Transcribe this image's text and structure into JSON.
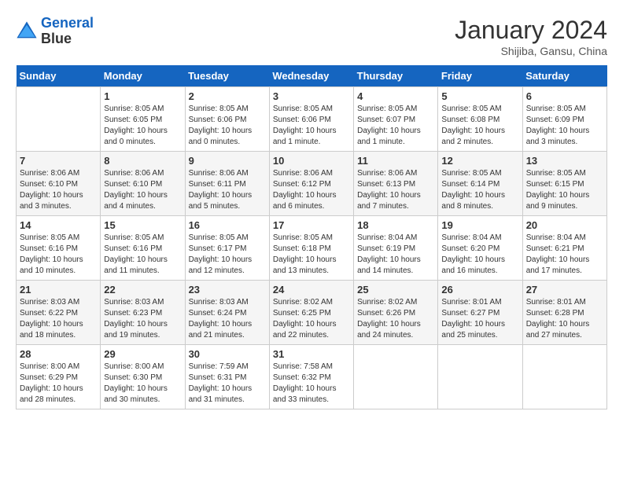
{
  "header": {
    "logo_line1": "General",
    "logo_line2": "Blue",
    "title": "January 2024",
    "subtitle": "Shijiba, Gansu, China"
  },
  "days_of_week": [
    "Sunday",
    "Monday",
    "Tuesday",
    "Wednesday",
    "Thursday",
    "Friday",
    "Saturday"
  ],
  "weeks": [
    [
      {
        "day": "",
        "sunrise": "",
        "sunset": "",
        "daylight": "",
        "empty": true
      },
      {
        "day": "1",
        "sunrise": "Sunrise: 8:05 AM",
        "sunset": "Sunset: 6:05 PM",
        "daylight": "Daylight: 10 hours and 0 minutes."
      },
      {
        "day": "2",
        "sunrise": "Sunrise: 8:05 AM",
        "sunset": "Sunset: 6:06 PM",
        "daylight": "Daylight: 10 hours and 0 minutes."
      },
      {
        "day": "3",
        "sunrise": "Sunrise: 8:05 AM",
        "sunset": "Sunset: 6:06 PM",
        "daylight": "Daylight: 10 hours and 1 minute."
      },
      {
        "day": "4",
        "sunrise": "Sunrise: 8:05 AM",
        "sunset": "Sunset: 6:07 PM",
        "daylight": "Daylight: 10 hours and 1 minute."
      },
      {
        "day": "5",
        "sunrise": "Sunrise: 8:05 AM",
        "sunset": "Sunset: 6:08 PM",
        "daylight": "Daylight: 10 hours and 2 minutes."
      },
      {
        "day": "6",
        "sunrise": "Sunrise: 8:05 AM",
        "sunset": "Sunset: 6:09 PM",
        "daylight": "Daylight: 10 hours and 3 minutes."
      }
    ],
    [
      {
        "day": "7",
        "sunrise": "Sunrise: 8:06 AM",
        "sunset": "Sunset: 6:10 PM",
        "daylight": "Daylight: 10 hours and 3 minutes."
      },
      {
        "day": "8",
        "sunrise": "Sunrise: 8:06 AM",
        "sunset": "Sunset: 6:10 PM",
        "daylight": "Daylight: 10 hours and 4 minutes."
      },
      {
        "day": "9",
        "sunrise": "Sunrise: 8:06 AM",
        "sunset": "Sunset: 6:11 PM",
        "daylight": "Daylight: 10 hours and 5 minutes."
      },
      {
        "day": "10",
        "sunrise": "Sunrise: 8:06 AM",
        "sunset": "Sunset: 6:12 PM",
        "daylight": "Daylight: 10 hours and 6 minutes."
      },
      {
        "day": "11",
        "sunrise": "Sunrise: 8:06 AM",
        "sunset": "Sunset: 6:13 PM",
        "daylight": "Daylight: 10 hours and 7 minutes."
      },
      {
        "day": "12",
        "sunrise": "Sunrise: 8:05 AM",
        "sunset": "Sunset: 6:14 PM",
        "daylight": "Daylight: 10 hours and 8 minutes."
      },
      {
        "day": "13",
        "sunrise": "Sunrise: 8:05 AM",
        "sunset": "Sunset: 6:15 PM",
        "daylight": "Daylight: 10 hours and 9 minutes."
      }
    ],
    [
      {
        "day": "14",
        "sunrise": "Sunrise: 8:05 AM",
        "sunset": "Sunset: 6:16 PM",
        "daylight": "Daylight: 10 hours and 10 minutes."
      },
      {
        "day": "15",
        "sunrise": "Sunrise: 8:05 AM",
        "sunset": "Sunset: 6:16 PM",
        "daylight": "Daylight: 10 hours and 11 minutes."
      },
      {
        "day": "16",
        "sunrise": "Sunrise: 8:05 AM",
        "sunset": "Sunset: 6:17 PM",
        "daylight": "Daylight: 10 hours and 12 minutes."
      },
      {
        "day": "17",
        "sunrise": "Sunrise: 8:05 AM",
        "sunset": "Sunset: 6:18 PM",
        "daylight": "Daylight: 10 hours and 13 minutes."
      },
      {
        "day": "18",
        "sunrise": "Sunrise: 8:04 AM",
        "sunset": "Sunset: 6:19 PM",
        "daylight": "Daylight: 10 hours and 14 minutes."
      },
      {
        "day": "19",
        "sunrise": "Sunrise: 8:04 AM",
        "sunset": "Sunset: 6:20 PM",
        "daylight": "Daylight: 10 hours and 16 minutes."
      },
      {
        "day": "20",
        "sunrise": "Sunrise: 8:04 AM",
        "sunset": "Sunset: 6:21 PM",
        "daylight": "Daylight: 10 hours and 17 minutes."
      }
    ],
    [
      {
        "day": "21",
        "sunrise": "Sunrise: 8:03 AM",
        "sunset": "Sunset: 6:22 PM",
        "daylight": "Daylight: 10 hours and 18 minutes."
      },
      {
        "day": "22",
        "sunrise": "Sunrise: 8:03 AM",
        "sunset": "Sunset: 6:23 PM",
        "daylight": "Daylight: 10 hours and 19 minutes."
      },
      {
        "day": "23",
        "sunrise": "Sunrise: 8:03 AM",
        "sunset": "Sunset: 6:24 PM",
        "daylight": "Daylight: 10 hours and 21 minutes."
      },
      {
        "day": "24",
        "sunrise": "Sunrise: 8:02 AM",
        "sunset": "Sunset: 6:25 PM",
        "daylight": "Daylight: 10 hours and 22 minutes."
      },
      {
        "day": "25",
        "sunrise": "Sunrise: 8:02 AM",
        "sunset": "Sunset: 6:26 PM",
        "daylight": "Daylight: 10 hours and 24 minutes."
      },
      {
        "day": "26",
        "sunrise": "Sunrise: 8:01 AM",
        "sunset": "Sunset: 6:27 PM",
        "daylight": "Daylight: 10 hours and 25 minutes."
      },
      {
        "day": "27",
        "sunrise": "Sunrise: 8:01 AM",
        "sunset": "Sunset: 6:28 PM",
        "daylight": "Daylight: 10 hours and 27 minutes."
      }
    ],
    [
      {
        "day": "28",
        "sunrise": "Sunrise: 8:00 AM",
        "sunset": "Sunset: 6:29 PM",
        "daylight": "Daylight: 10 hours and 28 minutes."
      },
      {
        "day": "29",
        "sunrise": "Sunrise: 8:00 AM",
        "sunset": "Sunset: 6:30 PM",
        "daylight": "Daylight: 10 hours and 30 minutes."
      },
      {
        "day": "30",
        "sunrise": "Sunrise: 7:59 AM",
        "sunset": "Sunset: 6:31 PM",
        "daylight": "Daylight: 10 hours and 31 minutes."
      },
      {
        "day": "31",
        "sunrise": "Sunrise: 7:58 AM",
        "sunset": "Sunset: 6:32 PM",
        "daylight": "Daylight: 10 hours and 33 minutes."
      },
      {
        "day": "",
        "sunrise": "",
        "sunset": "",
        "daylight": "",
        "empty": true
      },
      {
        "day": "",
        "sunrise": "",
        "sunset": "",
        "daylight": "",
        "empty": true
      },
      {
        "day": "",
        "sunrise": "",
        "sunset": "",
        "daylight": "",
        "empty": true
      }
    ]
  ]
}
